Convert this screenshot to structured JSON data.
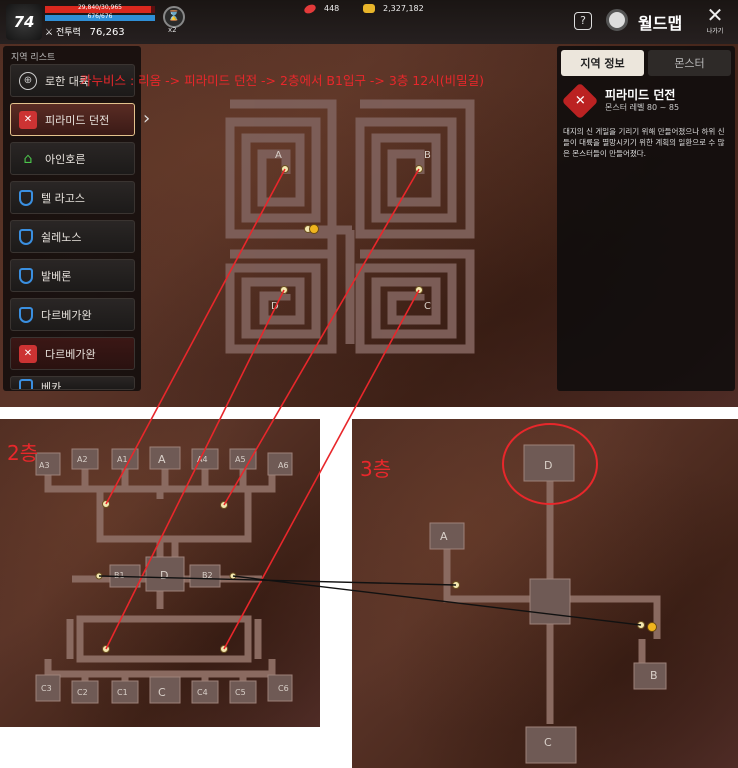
{
  "hud": {
    "level": "74",
    "hp_text": "29,840/30,965",
    "hp_ratio": 0.964,
    "mp_text": "676/676",
    "mp_ratio": 1.0,
    "power_label": "전투력",
    "power_value": "76,263",
    "buff_multiplier": "x2",
    "gems": "448",
    "gold": "2,327,182",
    "help_icon": "?",
    "title": "월드맵",
    "close_label": "나가기"
  },
  "region_list": {
    "title": "지역 리스트",
    "items": [
      {
        "label": "로한 대륙",
        "icon": "globe-icon"
      },
      {
        "label": "피라미드 던전",
        "icon": "dungeon-x-icon"
      },
      {
        "label": "아인호른",
        "icon": "home-icon"
      },
      {
        "label": "텔 라고스",
        "icon": "shield-icon"
      },
      {
        "label": "쉴레노스",
        "icon": "shield-icon"
      },
      {
        "label": "발베론",
        "icon": "shield-icon"
      },
      {
        "label": "다르베가완",
        "icon": "shield-icon"
      },
      {
        "label": "다르베가완",
        "icon": "dungeon-x-icon"
      },
      {
        "label": "베카",
        "icon": "shield-icon"
      }
    ]
  },
  "info_panel": {
    "tab_region": "지역 정보",
    "tab_monster": "몬스터",
    "dungeon_name": "피라미드 던전",
    "monster_level": "몬스터 레벨 80 ~ 85",
    "description": "대지의 신 게일을 기리기 위해 만들어졌으나 하위 신들이 대륙을 멸망시키기 위한 계획의 일환으로 수 많은 몬스터들이 만들어졌다."
  },
  "annotation": "카누비스 : 리옴 -> 피라미드 던전 -> 2층에서 B1입구 -> 3층 12시(비밀길)",
  "floor1_rooms": [
    "A",
    "B",
    "D",
    "C"
  ],
  "floor2": {
    "label": "2층",
    "top_rooms": [
      "A3",
      "A2",
      "A1",
      "A",
      "A4",
      "A5",
      "A6"
    ],
    "mid_rooms": [
      "B1",
      "D",
      "B2"
    ],
    "bottom_rooms": [
      "C3",
      "C2",
      "C1",
      "C",
      "C4",
      "C5",
      "C6"
    ]
  },
  "floor3": {
    "label": "3층",
    "rooms": [
      "D",
      "A",
      "B",
      "C"
    ]
  },
  "colors": {
    "annotation_red": "#e8272b",
    "corridor": "#8a6a60",
    "marker_yellow": "#f0b51e"
  }
}
